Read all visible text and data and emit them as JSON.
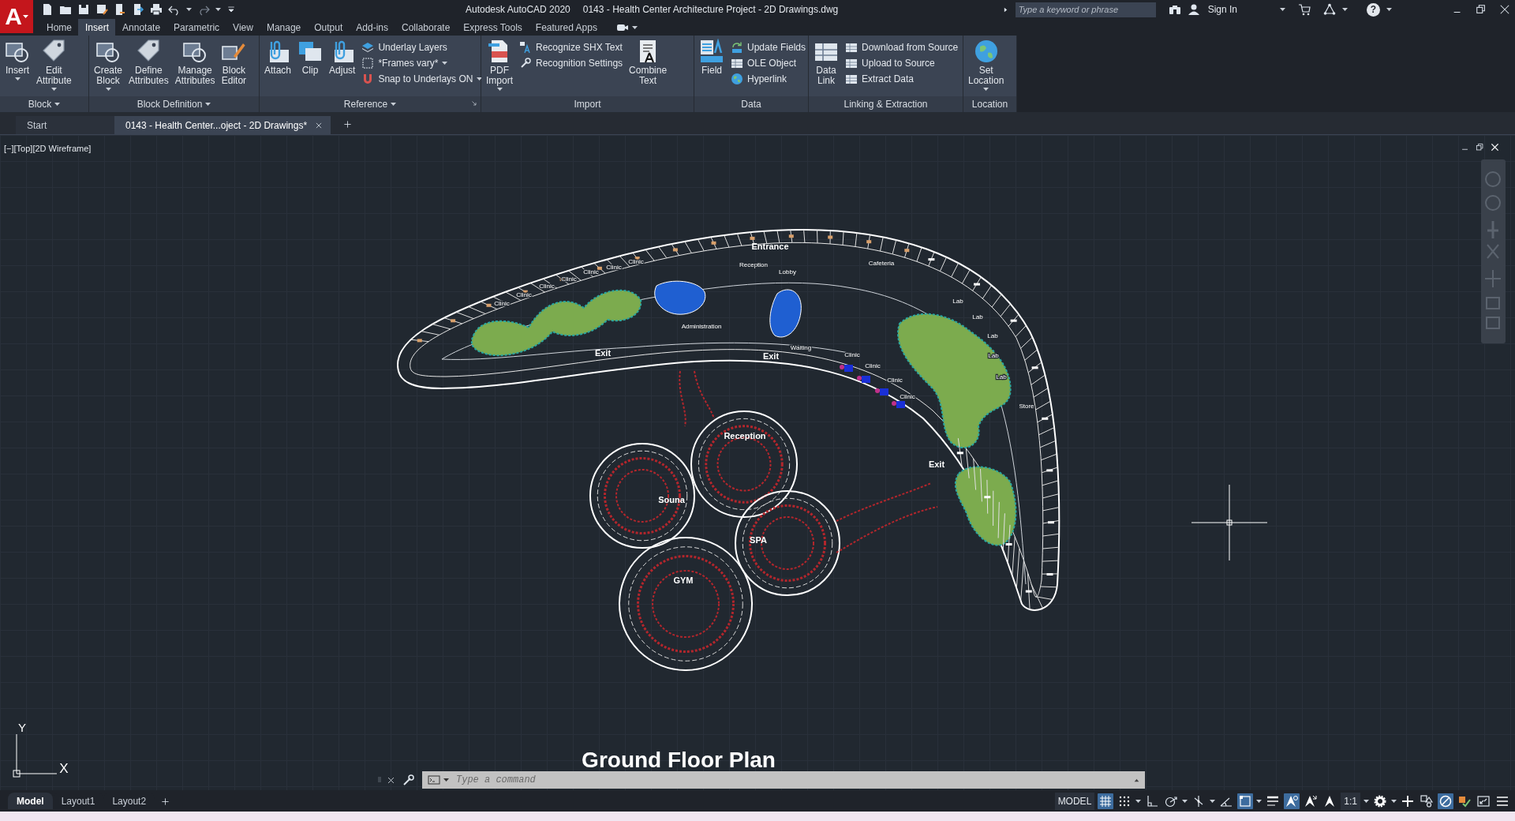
{
  "title_bar": {
    "logo": "A",
    "app": "Autodesk AutoCAD 2020",
    "document": "0143 - Health Center Architecture Project - 2D Drawings.dwg",
    "search": {
      "placeholder": "Type a keyword or phrase"
    },
    "sign_in": "Sign In",
    "help": "?"
  },
  "ribbon_tabs": [
    {
      "label": "Home",
      "selected": false
    },
    {
      "label": "Insert",
      "selected": true
    },
    {
      "label": "Annotate",
      "selected": false
    },
    {
      "label": "Parametric",
      "selected": false
    },
    {
      "label": "View",
      "selected": false
    },
    {
      "label": "Manage",
      "selected": false
    },
    {
      "label": "Output",
      "selected": false
    },
    {
      "label": "Add-ins",
      "selected": false
    },
    {
      "label": "Collaborate",
      "selected": false
    },
    {
      "label": "Express Tools",
      "selected": false
    },
    {
      "label": "Featured Apps",
      "selected": false
    }
  ],
  "ribbon_panels": [
    {
      "title": "Block",
      "menu": true,
      "items": [
        {
          "kind": "large",
          "label": "Insert",
          "menu": true
        },
        {
          "kind": "large",
          "label": "Edit Attribute",
          "menu": true
        }
      ]
    },
    {
      "title": "Block Definition",
      "menu": true,
      "items": [
        {
          "kind": "large",
          "label": "Create Block",
          "menu": true
        },
        {
          "kind": "large",
          "label": "Define Attributes"
        },
        {
          "kind": "large",
          "label": "Manage Attributes"
        },
        {
          "kind": "large",
          "label": "Block Editor"
        }
      ]
    },
    {
      "title": "Reference",
      "menu": true,
      "launcher": true,
      "items": [
        {
          "kind": "large",
          "label": "Attach"
        },
        {
          "kind": "large",
          "label": "Clip"
        },
        {
          "kind": "large",
          "label": "Adjust"
        },
        {
          "kind": "stack",
          "items": [
            {
              "label": "Underlay Layers"
            },
            {
              "label": "*Frames vary*",
              "menu": true
            },
            {
              "label": "Snap to Underlays ON",
              "menu": true
            }
          ]
        }
      ]
    },
    {
      "title": "Import",
      "items": [
        {
          "kind": "large",
          "label": "PDF Import",
          "menu": true
        },
        {
          "kind": "stack",
          "items": [
            {
              "label": "Recognize SHX Text"
            },
            {
              "label": "Recognition Settings"
            }
          ]
        },
        {
          "kind": "large",
          "label": "Combine Text"
        }
      ]
    },
    {
      "title": "Data",
      "items": [
        {
          "kind": "large",
          "label": "Field"
        },
        {
          "kind": "stack",
          "items": [
            {
              "label": "Update Fields"
            },
            {
              "label": "OLE Object"
            },
            {
              "label": "Hyperlink"
            }
          ]
        }
      ]
    },
    {
      "title": "Linking & Extraction",
      "items": [
        {
          "kind": "large",
          "label": "Data Link"
        },
        {
          "kind": "stack",
          "items": [
            {
              "label": "Download from Source"
            },
            {
              "label": "Upload to Source"
            },
            {
              "label": "Extract  Data"
            }
          ]
        }
      ]
    },
    {
      "title": "Location",
      "items": [
        {
          "kind": "large",
          "label": "Set Location",
          "menu": true
        }
      ]
    }
  ],
  "file_tabs": [
    {
      "label": "Start",
      "selected": false
    },
    {
      "label": "0143 - Health Center...oject - 2D Drawings*",
      "selected": true,
      "closable": true
    }
  ],
  "viewport": {
    "label": "[−][Top][2D Wireframe]",
    "caption": "Ground Floor Plan",
    "ucs": {
      "y": "Y",
      "x": "X"
    },
    "labels": [
      {
        "text": "Entrance",
        "kind": "heading"
      },
      {
        "text": "Reception",
        "kind": "room"
      },
      {
        "text": "Lobby",
        "kind": "room"
      },
      {
        "text": "Cafeteria",
        "kind": "room"
      },
      {
        "text": "Clinic",
        "kind": "room"
      },
      {
        "text": "Clinic",
        "kind": "room"
      },
      {
        "text": "Clinic",
        "kind": "room"
      },
      {
        "text": "Clinic",
        "kind": "room"
      },
      {
        "text": "Clinic",
        "kind": "room"
      },
      {
        "text": "Clinic",
        "kind": "room"
      },
      {
        "text": "Clinic",
        "kind": "room"
      },
      {
        "text": "Administration",
        "kind": "room"
      },
      {
        "text": "Waiting",
        "kind": "room"
      },
      {
        "text": "Exit",
        "kind": "heading"
      },
      {
        "text": "Exit",
        "kind": "heading"
      },
      {
        "text": "Lab",
        "kind": "room"
      },
      {
        "text": "Lab",
        "kind": "room"
      },
      {
        "text": "Lab",
        "kind": "room"
      },
      {
        "text": "Lab",
        "kind": "room"
      },
      {
        "text": "Lab",
        "kind": "room"
      },
      {
        "text": "Clinic",
        "kind": "room"
      },
      {
        "text": "Clinic",
        "kind": "room"
      },
      {
        "text": "Clinic",
        "kind": "room"
      },
      {
        "text": "Clinic",
        "kind": "room"
      },
      {
        "text": "Store",
        "kind": "room"
      },
      {
        "text": "Reception",
        "kind": "heading"
      },
      {
        "text": "Exit",
        "kind": "heading"
      },
      {
        "text": "Souna",
        "kind": "heading"
      },
      {
        "text": "SPA",
        "kind": "heading"
      },
      {
        "text": "GYM",
        "kind": "heading"
      }
    ]
  },
  "command_line": {
    "placeholder": "Type a command"
  },
  "layout_tabs": [
    {
      "label": "Model",
      "selected": true
    },
    {
      "label": "Layout1",
      "selected": false
    },
    {
      "label": "Layout2",
      "selected": false
    }
  ],
  "status_bar": {
    "space": "MODEL",
    "scale": "1:1",
    "toggles": [
      {
        "on": true
      },
      {
        "on": false
      },
      {
        "on": false
      },
      {
        "on": false
      },
      {
        "on": false
      },
      {
        "on": false
      },
      {
        "on": true
      },
      {
        "on": false
      },
      {
        "on": true
      },
      {
        "on": false
      },
      {
        "on": false
      },
      {
        "on": false
      },
      {
        "on": false
      },
      {
        "on": false
      },
      {
        "on": true
      },
      {
        "on": false
      },
      {
        "on": false
      },
      {
        "on": false
      }
    ]
  }
}
